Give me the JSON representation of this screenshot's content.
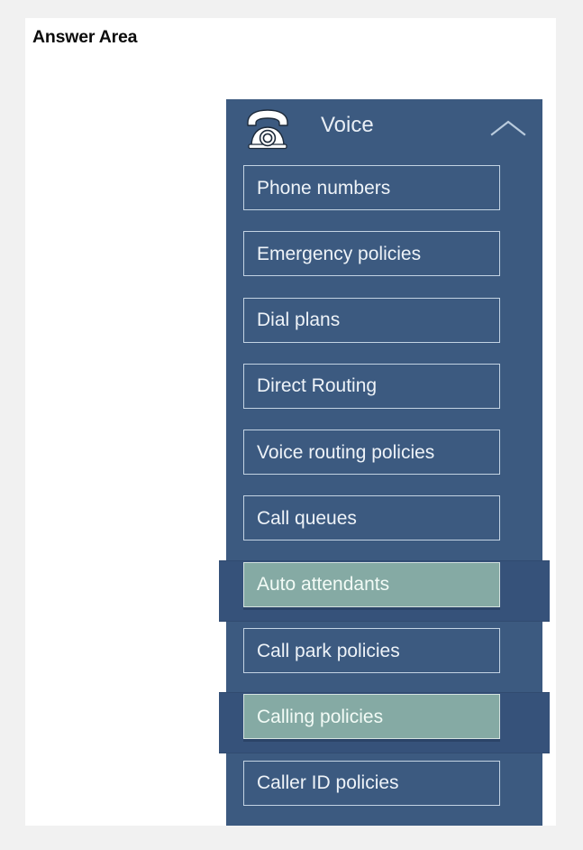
{
  "page": {
    "title": "Answer Area",
    "background_color": "#f1f1f1",
    "card_color": "#ffffff"
  },
  "voice_panel": {
    "header": {
      "title": "Voice",
      "phone_icon": "desk-phone-icon",
      "collapse_icon": "chevron-up-icon"
    },
    "colors": {
      "panel": "#3c5a80",
      "item_border": "#c3d3e3",
      "item_text": "#eef3f8",
      "highlight": "#85aaa4",
      "highlight_text": "#f2fbf6",
      "selection_band": "#36527a"
    },
    "items": [
      {
        "label": "Phone numbers",
        "selected": false
      },
      {
        "label": "Emergency policies",
        "selected": false
      },
      {
        "label": "Dial plans",
        "selected": false
      },
      {
        "label": "Direct Routing",
        "selected": false
      },
      {
        "label": "Voice routing policies",
        "selected": false
      },
      {
        "label": "Call queues",
        "selected": false
      },
      {
        "label": "Auto attendants",
        "selected": true
      },
      {
        "label": "Call park policies",
        "selected": false
      },
      {
        "label": "Calling policies",
        "selected": true
      },
      {
        "label": "Caller ID policies",
        "selected": false
      }
    ]
  }
}
